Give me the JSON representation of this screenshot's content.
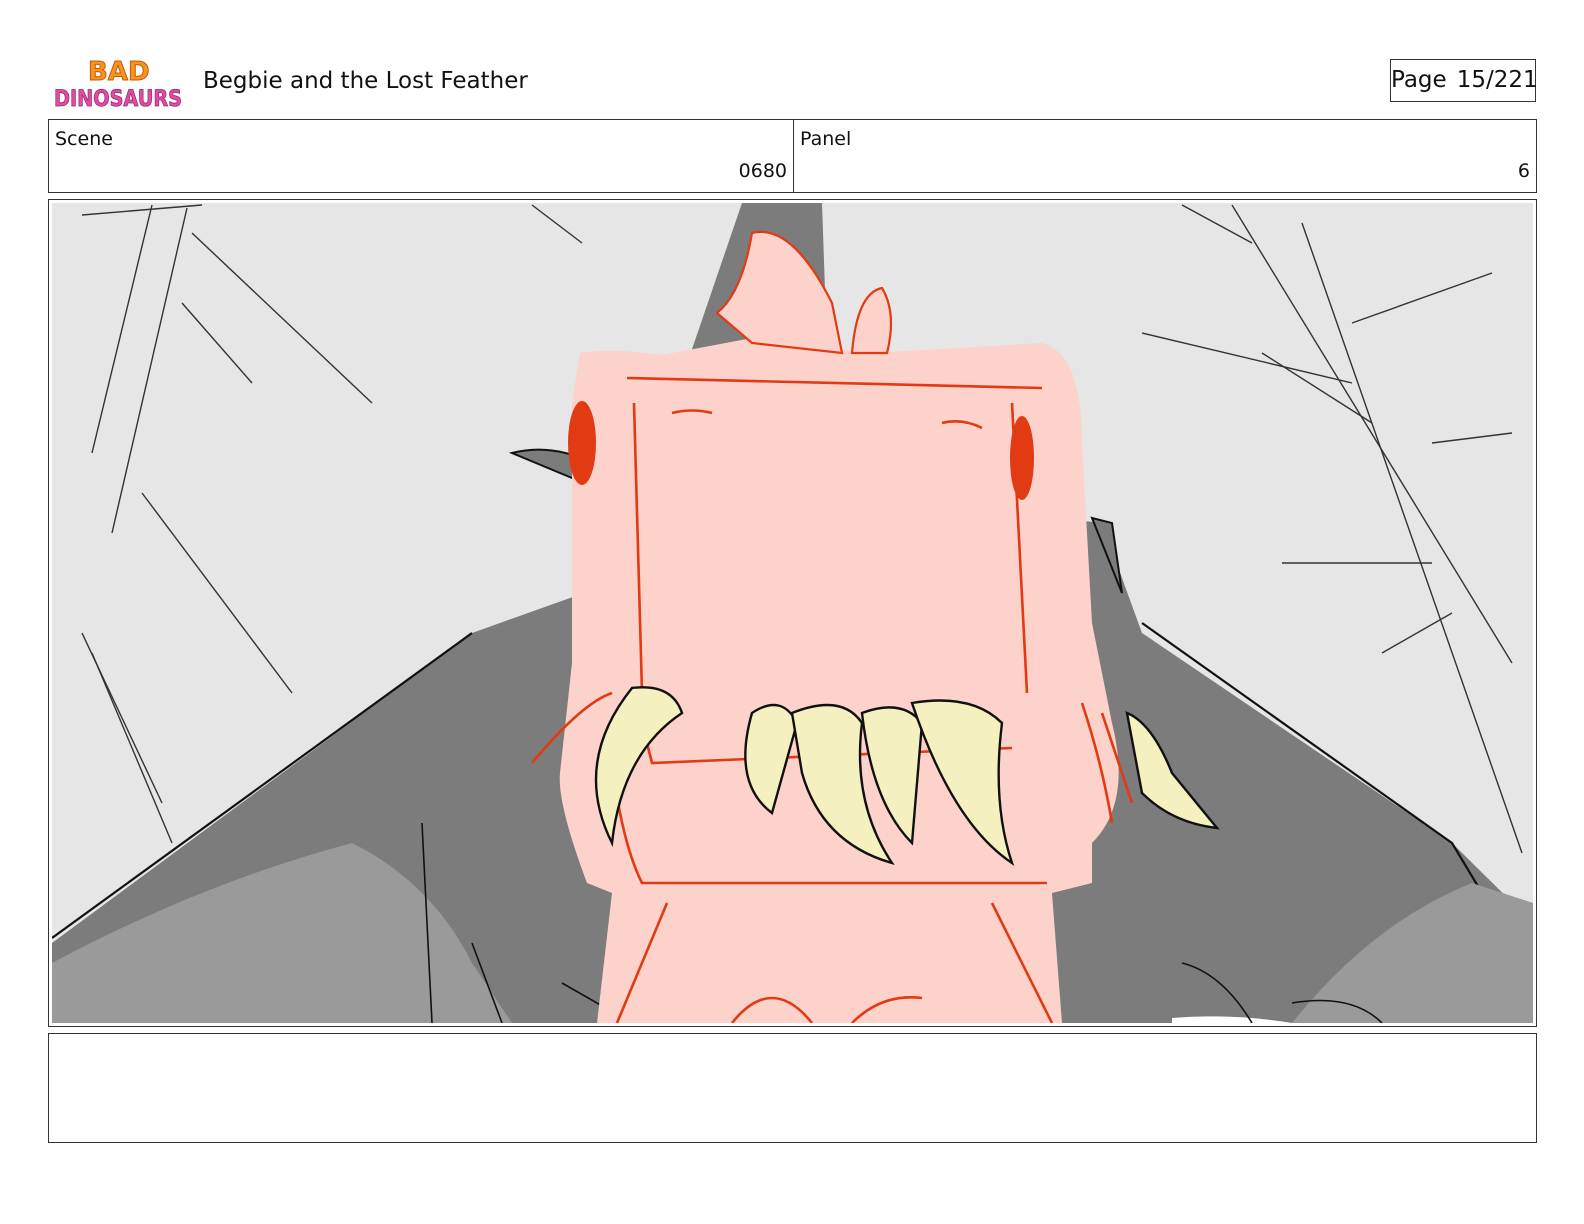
{
  "header": {
    "logo_line1": "BAD",
    "logo_line2": "DINOSAURS",
    "title": "Begbie and the Lost Feather",
    "page_label": "Page",
    "page_number": "15/221"
  },
  "info": {
    "scene_label": "Scene",
    "scene_value": "0680",
    "panel_label": "Panel",
    "panel_value": "6"
  },
  "panel_image": {
    "colors": {
      "sky": "#e6e6e6",
      "shadow_dark": "#7c7c7c",
      "shadow_mid": "#9a9a9a",
      "skin": "#fcd2ca",
      "line_red": "#e23a12",
      "teeth": "#f5f0c0"
    }
  },
  "notes": {
    "text": ""
  }
}
